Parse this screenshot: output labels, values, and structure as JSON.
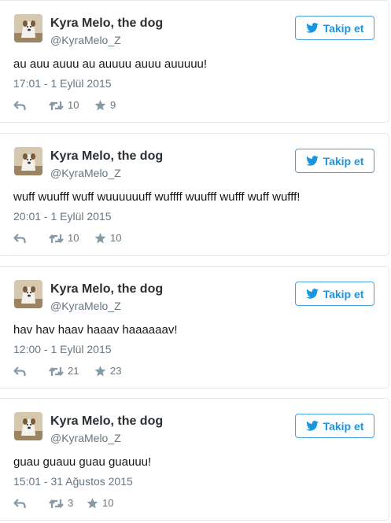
{
  "colors": {
    "follow_blue": "#1b95e0",
    "border": "#e1e8ed",
    "meta_gray": "#66757f",
    "icon_gray": "#8899a6"
  },
  "icons": {
    "follow": "twitter-bird-icon",
    "reply": "reply-arrow-icon",
    "retweet": "retweet-icon",
    "like": "star-icon"
  },
  "tweets": [
    {
      "name": "Kyra Melo, the dog",
      "handle": "@KyraMelo_Z",
      "follow_label": "Takip et",
      "text": "au auu auuu au auuuu auuu auuuuu!",
      "timestamp": "17:01 - 1 Eylül 2015",
      "retweets": "10",
      "likes": "9"
    },
    {
      "name": "Kyra Melo, the dog",
      "handle": "@KyraMelo_Z",
      "follow_label": "Takip et",
      "text": "wuff wuufff wuff wuuuuuuff wuffff wuufff wufff wuff wufff!",
      "timestamp": "20:01 - 1 Eylül 2015",
      "retweets": "10",
      "likes": "10"
    },
    {
      "name": "Kyra Melo, the dog",
      "handle": "@KyraMelo_Z",
      "follow_label": "Takip et",
      "text": "hav hav haav haaav haaaaaav!",
      "timestamp": "12:00 - 1 Eylül 2015",
      "retweets": "21",
      "likes": "23"
    },
    {
      "name": "Kyra Melo, the dog",
      "handle": "@KyraMelo_Z",
      "follow_label": "Takip et",
      "text": "guau guauu guau guauuu!",
      "timestamp": "15:01 - 31 Ağustos 2015",
      "retweets": "3",
      "likes": "10"
    }
  ]
}
